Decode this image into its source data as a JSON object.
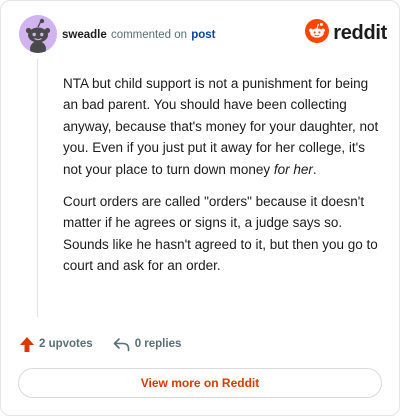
{
  "header": {
    "author": "sweadle",
    "action_text": "commented on",
    "post_link": "post",
    "brand": "reddit"
  },
  "comment": {
    "paragraph1_text": "NTA but child support is not a punishment for being an bad parent. You should have been collecting anyway, because that's money for your daughter, not you. Even if you just put it away for her college, it's not your place to turn down money ",
    "paragraph1_emphasis": "for her",
    "paragraph1_end": ".",
    "paragraph2": "Court orders are called \"orders\" because it doesn't matter if he agrees or signs it, a judge says so. Sounds like he hasn't agreed to it, but then you go to court and ask for an order."
  },
  "footer": {
    "upvotes_label": "2 upvotes",
    "replies_label": "0 replies"
  },
  "actions": {
    "view_more_label": "View more on Reddit"
  },
  "icons": {
    "avatar": "snoo-avatar-icon",
    "brand": "reddit-snoo-icon",
    "upvote": "upvote-arrow-icon",
    "reply": "reply-arrow-icon"
  },
  "colors": {
    "brand_orange": "#ff4500",
    "upvote_arrow": "#d93900",
    "view_more_text": "#d93900",
    "post_link": "#0a449b",
    "avatar_bg": "#d1b3f0",
    "muted_text": "#576f76"
  }
}
